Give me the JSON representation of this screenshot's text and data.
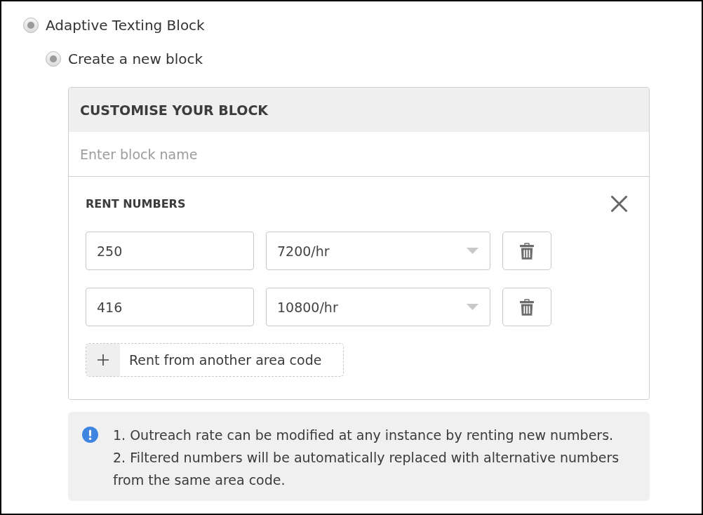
{
  "options": [
    {
      "label": "Adaptive Texting Block",
      "selected": true,
      "children": [
        {
          "label": "Create a new block",
          "selected": true
        }
      ]
    }
  ],
  "customise_panel": {
    "title": "CUSTOMISE YOUR BLOCK",
    "name_field": {
      "placeholder": "Enter block name"
    },
    "rent_numbers": {
      "title": "RENT NUMBERS",
      "rows": [
        {
          "area_code": "250",
          "rate": "7200/hr"
        },
        {
          "area_code": "416",
          "rate": "10800/hr"
        }
      ],
      "add_button": "Rent from another area code"
    }
  },
  "notes": [
    "1. Outreach rate can be modified at any instance by renting new numbers.",
    "2. Filtered numbers will be automatically replaced with alternative numbers from the same area code."
  ]
}
